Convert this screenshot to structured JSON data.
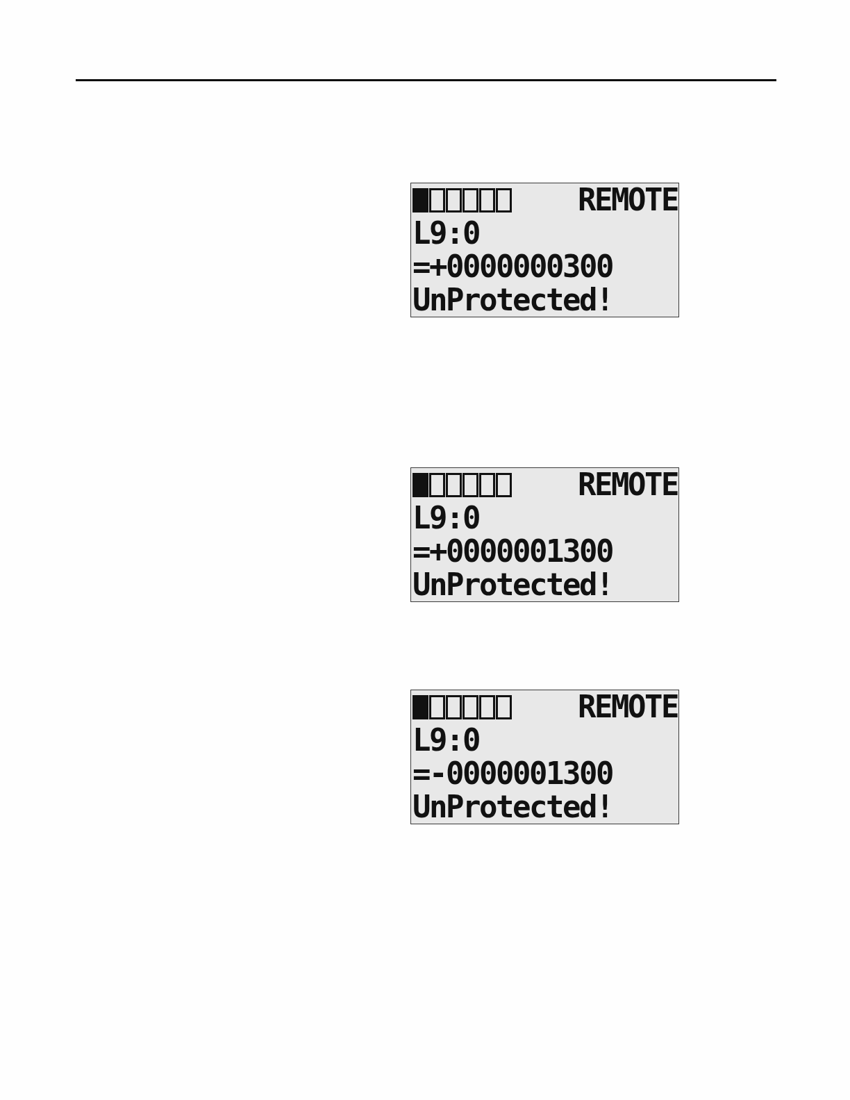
{
  "displays": [
    {
      "indicators": [
        {
          "on": true
        },
        {
          "on": false
        },
        {
          "on": false
        },
        {
          "on": false
        },
        {
          "on": false
        },
        {
          "on": false
        }
      ],
      "mode": "REMOTE",
      "address": "L9:0",
      "value": "=+0000000300",
      "status": "UnProtected!"
    },
    {
      "indicators": [
        {
          "on": true
        },
        {
          "on": false
        },
        {
          "on": false
        },
        {
          "on": false
        },
        {
          "on": false
        },
        {
          "on": false
        }
      ],
      "mode": "REMOTE",
      "address": "L9:0",
      "value": "=+0000001300",
      "status": "UnProtected!"
    },
    {
      "indicators": [
        {
          "on": true
        },
        {
          "on": false
        },
        {
          "on": false
        },
        {
          "on": false
        },
        {
          "on": false
        },
        {
          "on": false
        }
      ],
      "mode": "REMOTE",
      "address": "L9:0",
      "value": "=-0000001300",
      "status": "UnProtected!"
    }
  ]
}
